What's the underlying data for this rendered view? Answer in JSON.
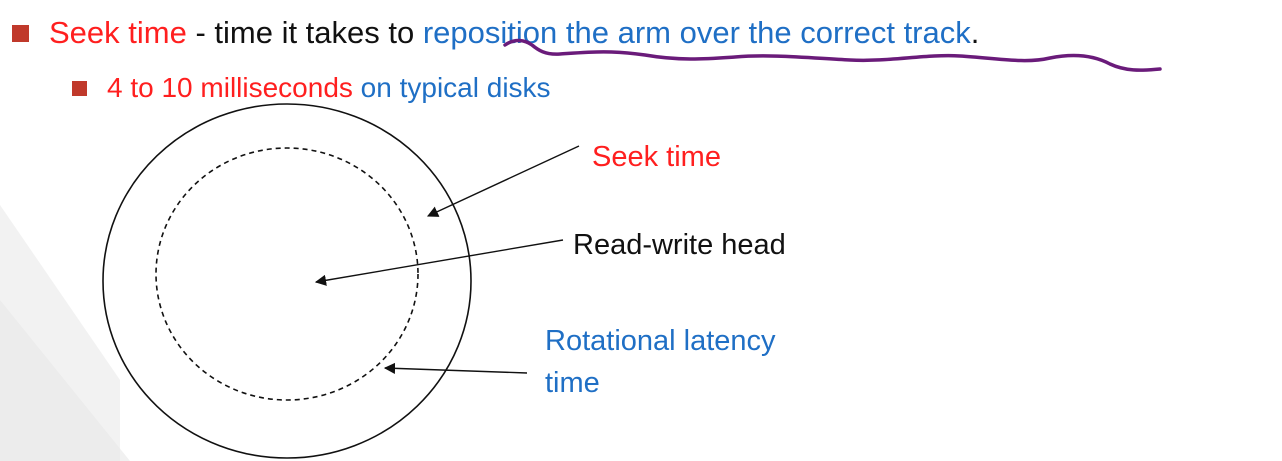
{
  "bullets": {
    "main": {
      "term": "Seek time",
      "separator": " - time it takes to ",
      "emphasis": "reposition the arm over the correct track",
      "ending": "."
    },
    "sub": {
      "value": "4 to 10 milliseconds",
      "context": " on typical disks"
    }
  },
  "diagram": {
    "labels": {
      "seek_time": "Seek time",
      "read_write_head": "Read-write head",
      "rotational_latency_line1": "Rotational latency",
      "rotational_latency_line2": "time"
    }
  },
  "colors": {
    "bullet_square": "#c0392b",
    "red_text": "#ff1f1f",
    "blue_text": "#1f6fc5",
    "handwritten_underline": "#6a1b7a"
  }
}
